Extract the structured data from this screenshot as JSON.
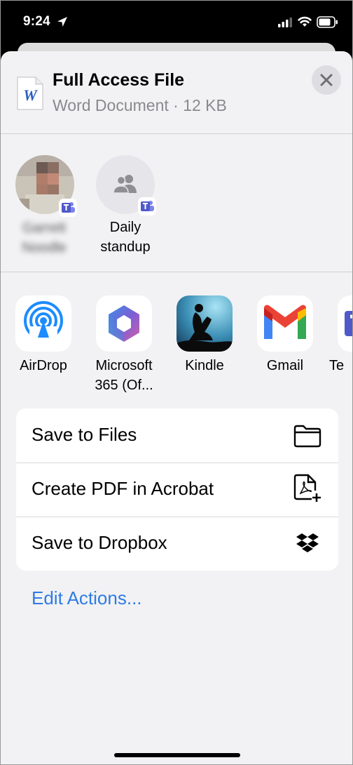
{
  "status_bar": {
    "time": "9:24"
  },
  "header": {
    "title": "Full Access File",
    "subtitle": "Word Document · 12 KB",
    "doc_letter": "W"
  },
  "people": [
    {
      "name_line1": "Garrett",
      "name_line2": "Noodle",
      "blurred": true,
      "badge": "microsoft-teams-icon"
    },
    {
      "name_line1": "Daily",
      "name_line2": "standup",
      "blurred": false,
      "badge": "microsoft-teams-icon"
    }
  ],
  "apps": [
    {
      "label": "AirDrop",
      "icon": "airdrop-icon"
    },
    {
      "label_line1": "Microsoft",
      "label_line2": "365  (Of...",
      "icon": "microsoft-365-icon"
    },
    {
      "label": "Kindle",
      "icon": "kindle-icon"
    },
    {
      "label": "Gmail",
      "icon": "gmail-icon"
    },
    {
      "label": "Te",
      "icon": "teams-icon"
    }
  ],
  "actions": [
    {
      "label": "Save to Files",
      "icon": "folder-icon"
    },
    {
      "label": "Create PDF in Acrobat",
      "icon": "acrobat-add-icon"
    },
    {
      "label": "Save to Dropbox",
      "icon": "dropbox-icon"
    }
  ],
  "edit_actions_label": "Edit Actions...",
  "colors": {
    "link": "#2f7be6",
    "sheet_bg": "#f2f2f4",
    "secondary_text": "#8a8a8e"
  }
}
